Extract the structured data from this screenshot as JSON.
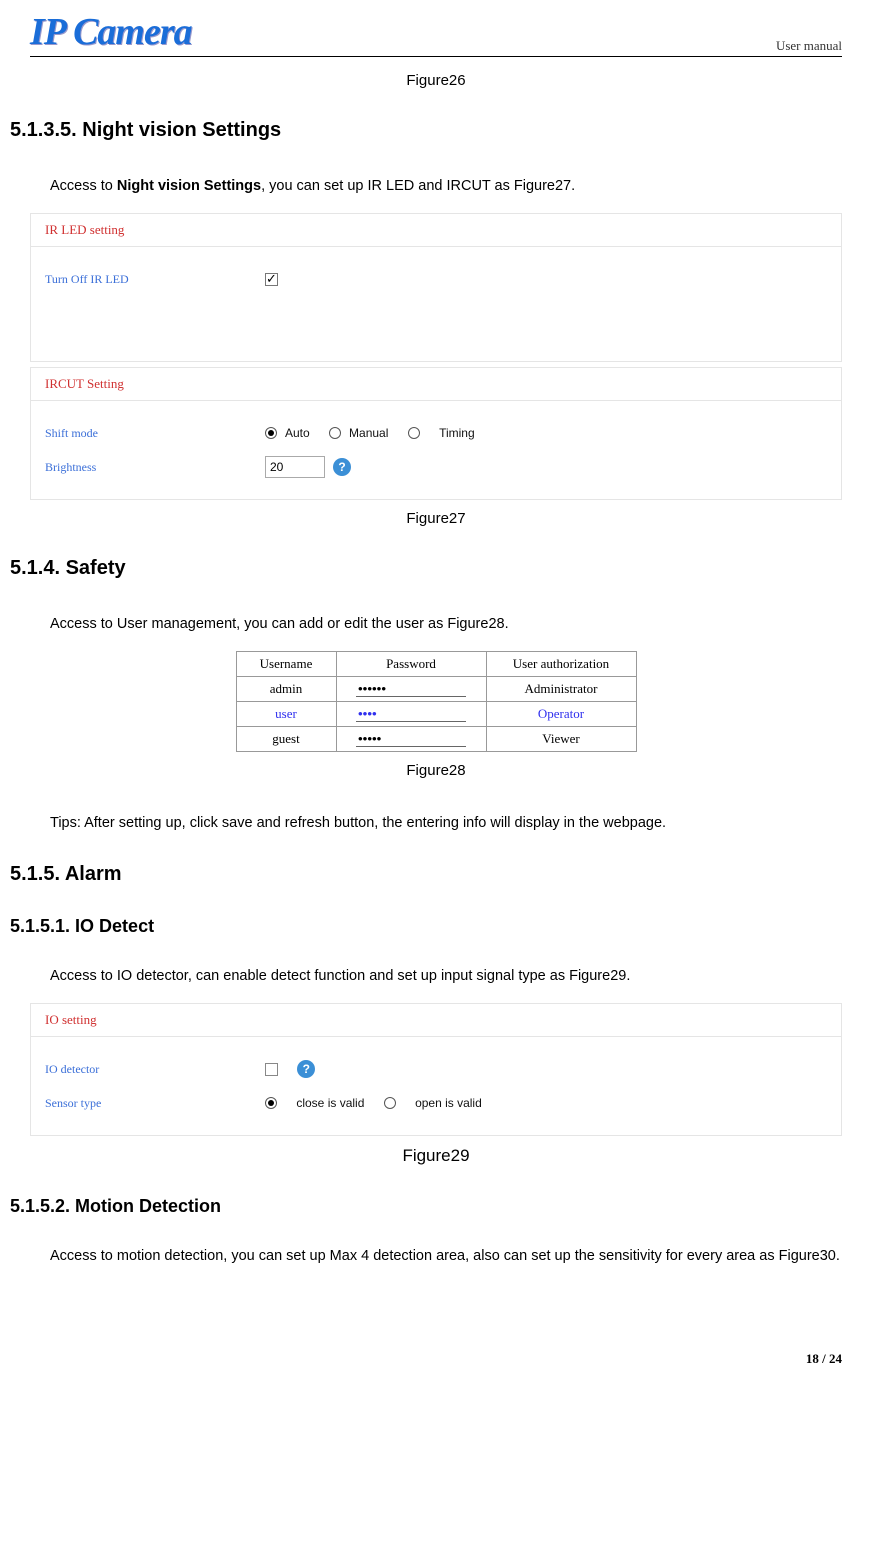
{
  "header": {
    "logo": "IP Camera",
    "label": "User manual"
  },
  "cap26": "Figure26",
  "sec_night": {
    "heading": "5.1.3.5. Night vision Settings",
    "intro_pre": "Access to ",
    "intro_bold": "Night vision Settings",
    "intro_post": ", you can set up IR LED and IRCUT as Figure27."
  },
  "panel_ir": {
    "title": "IR LED setting",
    "turn_off": "Turn Off IR LED"
  },
  "panel_ircut": {
    "title": "IRCUT Setting",
    "shift": "Shift mode",
    "auto": "Auto",
    "manual": "Manual",
    "timing": "Timing",
    "brightness": "Brightness",
    "brightness_val": "20"
  },
  "cap27": "Figure27",
  "sec_safety": {
    "heading": "5.1.4.  Safety",
    "intro": "Access to User management, you can add or edit the user as Figure28.",
    "tips": "Tips: After setting up, click save and refresh button, the entering info will display in the webpage."
  },
  "user_table": {
    "h1": "Username",
    "h2": "Password",
    "h3": "User authorization",
    "r1c1": "admin",
    "r1c2": "••••••",
    "r1c3": "Administrator",
    "r2c1": "user",
    "r2c2": "••••",
    "r2c3": "Operator",
    "r3c1": "guest",
    "r3c2": "•••••",
    "r3c3": "Viewer"
  },
  "cap28": "Figure28",
  "sec_alarm": {
    "heading": "5.1.5.  Alarm"
  },
  "sec_io": {
    "heading": "5.1.5.1. IO Detect",
    "intro": "Access to IO detector, can enable detect function and set up input signal type as Figure29."
  },
  "panel_io": {
    "title": "IO setting",
    "detector": "IO detector",
    "sensor": "Sensor type",
    "close_valid": "close is valid",
    "open_valid": "open is valid"
  },
  "cap29": "Figure29",
  "sec_motion": {
    "heading": "5.1.5.2. Motion Detection",
    "intro": "Access to motion detection, you can set up Max 4 detection area, also can set up the sensitivity for every area as Figure30."
  },
  "footer": "18 / 24"
}
